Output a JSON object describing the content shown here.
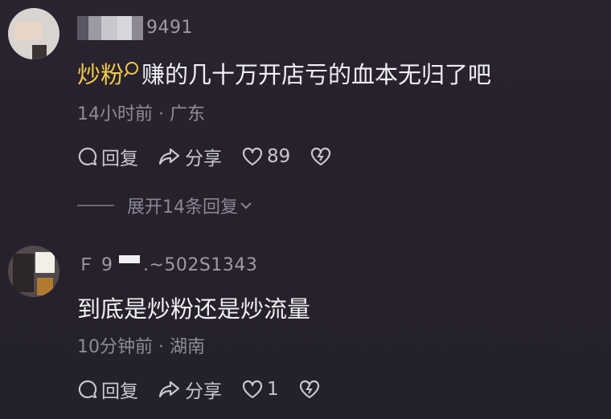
{
  "comments": [
    {
      "username_suffix": "9491",
      "mention": "炒粉",
      "text": "赚的几十万开店亏的血本无归了吧",
      "time": "14小时前",
      "location": "广东",
      "reply_label": "回复",
      "share_label": "分享",
      "like_count": "89",
      "expand_label": "展开14条回复"
    },
    {
      "username_visible": "Ｆ 9",
      "username_suffix": ".~502S1343",
      "text": "到底是炒粉还是炒流量",
      "time": "10分钟前",
      "location": "湖南",
      "reply_label": "回复",
      "share_label": "分享",
      "like_count": "1"
    }
  ],
  "separator": "·",
  "icons": {
    "reply": "comment-bubble-icon",
    "share": "share-arrow-icon",
    "like": "heart-icon",
    "dislike": "broken-heart-icon",
    "expand": "chevron-down-icon",
    "mention_marker": "search-icon"
  },
  "colors": {
    "mention": "#f2c94c",
    "background": "#27222c",
    "text": "#f1eff3",
    "meta": "#8f8b98"
  }
}
